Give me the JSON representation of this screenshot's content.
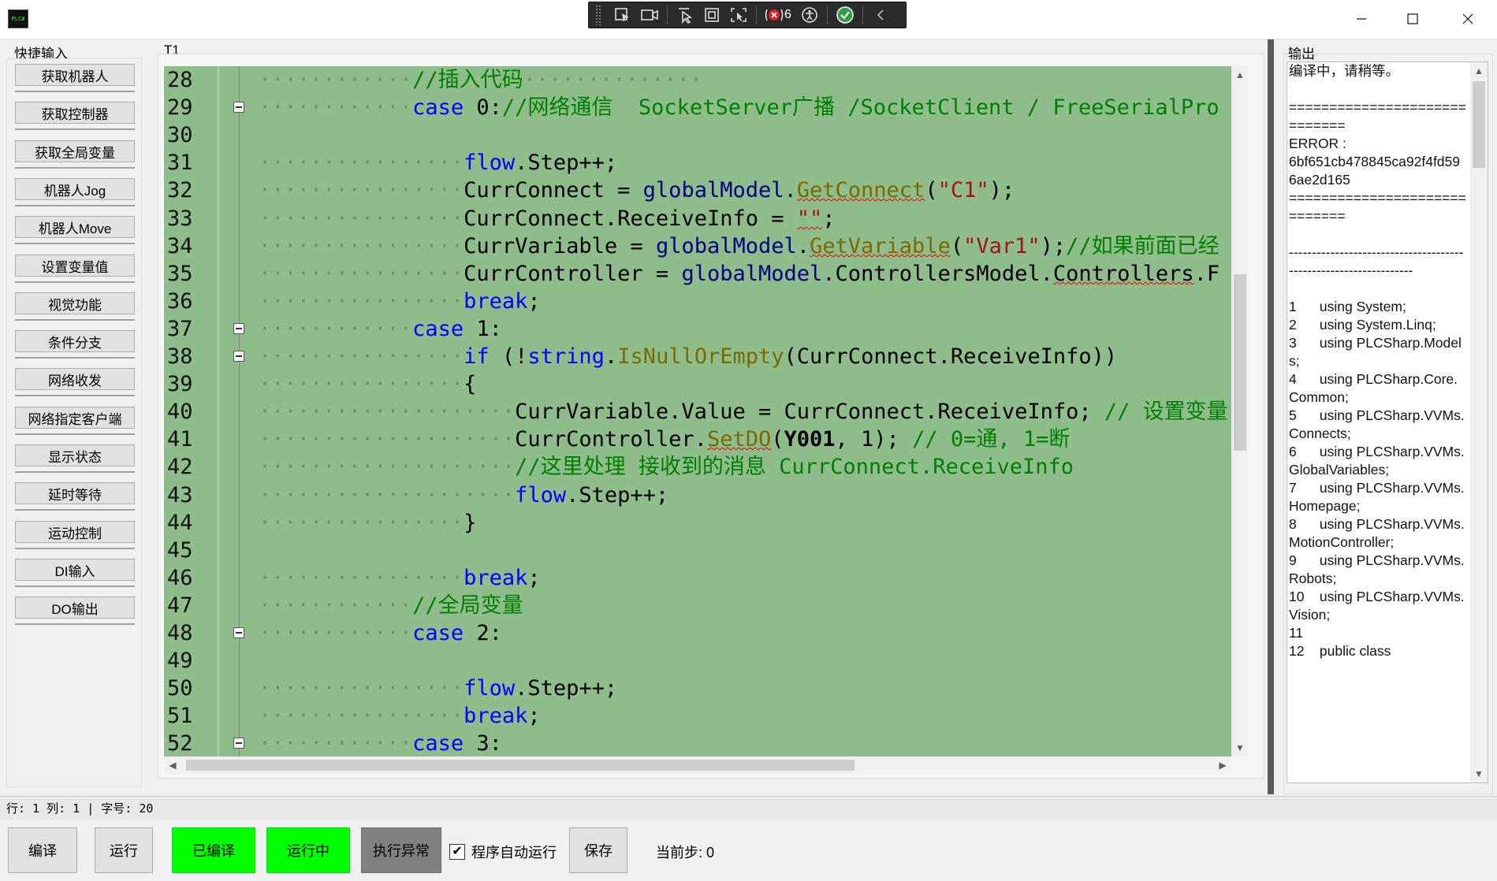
{
  "titlebar": {
    "app_icon_label": "PLC#",
    "window_controls": [
      "minimize",
      "maximize",
      "close"
    ],
    "debug_toolbar": {
      "icons": [
        "select-element-icon",
        "live-camera-icon",
        "pointer-icon",
        "frame-icon",
        "track-focus-icon",
        "binding-errors-icon",
        "accessibility-icon",
        "check-icon",
        "collapse-icon"
      ],
      "binding_error_count": "6"
    }
  },
  "quick_panel": {
    "title": "快捷输入",
    "buttons": [
      "获取机器人",
      "获取控制器",
      "获取全局变量",
      "机器人Jog",
      "机器人Move",
      "设置变量值",
      "视觉功能",
      "条件分支",
      "网络收发",
      "网络指定客户端",
      "显示状态",
      "延时等待",
      "运动控制",
      "DI输入",
      "DO输出"
    ]
  },
  "editor": {
    "tab": "T1",
    "background": "#8fbc8b",
    "lines": [
      {
        "n": "28",
        "dots": 12,
        "segs": [
          [
            "cm",
            "//插入代码"
          ],
          [
            "dots",
            "··············"
          ]
        ]
      },
      {
        "n": "29",
        "fold": true,
        "dots": 12,
        "segs": [
          [
            "kw",
            "case"
          ],
          [
            "",
            " 0:"
          ],
          [
            "cm",
            "//网络通信  SocketServer广播 /SocketClient / FreeSerialPro"
          ]
        ]
      },
      {
        "n": "30",
        "dots": 0,
        "segs": []
      },
      {
        "n": "31",
        "dots": 16,
        "segs": [
          [
            "kw",
            "flow"
          ],
          [
            "",
            ".Step++;"
          ]
        ]
      },
      {
        "n": "32",
        "dots": 16,
        "segs": [
          [
            "",
            "CurrConnect = "
          ],
          [
            "ty",
            "globalModel"
          ],
          [
            "",
            "."
          ],
          [
            "mt squig",
            "GetConnect"
          ],
          [
            "",
            "("
          ],
          [
            "st",
            "\"C1\""
          ],
          [
            "",
            ");"
          ]
        ]
      },
      {
        "n": "33",
        "dots": 16,
        "segs": [
          [
            "",
            "CurrConnect.ReceiveInfo = "
          ],
          [
            "st squig",
            "\"\""
          ],
          [
            "",
            ";"
          ]
        ]
      },
      {
        "n": "34",
        "dots": 16,
        "segs": [
          [
            "",
            "CurrVariable = "
          ],
          [
            "ty",
            "globalModel"
          ],
          [
            "",
            "."
          ],
          [
            "mt squig",
            "GetVariable"
          ],
          [
            "",
            "("
          ],
          [
            "st",
            "\"Var1\""
          ],
          [
            "",
            ");"
          ],
          [
            "cm",
            "//如果前面已经"
          ]
        ]
      },
      {
        "n": "35",
        "dots": 16,
        "segs": [
          [
            "",
            "CurrController = "
          ],
          [
            "ty",
            "globalModel"
          ],
          [
            "",
            ".ControllersModel."
          ],
          [
            "squig",
            "Controllers"
          ],
          [
            "",
            ".F"
          ]
        ]
      },
      {
        "n": "36",
        "dots": 16,
        "segs": [
          [
            "kw",
            "break"
          ],
          [
            "",
            ";"
          ]
        ]
      },
      {
        "n": "37",
        "fold": true,
        "dots": 12,
        "segs": [
          [
            "kw",
            "case"
          ],
          [
            "",
            " 1:"
          ]
        ]
      },
      {
        "n": "38",
        "fold": true,
        "dots": 16,
        "segs": [
          [
            "kw",
            "if"
          ],
          [
            "",
            " (!"
          ],
          [
            "kw",
            "string"
          ],
          [
            "",
            "."
          ],
          [
            "mt",
            "IsNullOrEmpty"
          ],
          [
            "",
            "(CurrConnect.ReceiveInfo))"
          ]
        ]
      },
      {
        "n": "39",
        "dots": 16,
        "segs": [
          [
            "",
            "{"
          ]
        ]
      },
      {
        "n": "40",
        "dots": 20,
        "segs": [
          [
            "",
            "CurrVariable.Value = CurrConnect.ReceiveInfo; "
          ],
          [
            "cm",
            "// 设置变量"
          ]
        ]
      },
      {
        "n": "41",
        "dots": 20,
        "segs": [
          [
            "",
            "CurrController."
          ],
          [
            "mt squig",
            "SetDO"
          ],
          [
            "",
            "("
          ],
          [
            "bd",
            "Y001"
          ],
          [
            "",
            ", 1); "
          ],
          [
            "cm",
            "// 0=通, 1=断"
          ]
        ]
      },
      {
        "n": "42",
        "dots": 20,
        "segs": [
          [
            "cm",
            "//这里处理 接收到的消息 CurrConnect.ReceiveInfo"
          ]
        ]
      },
      {
        "n": "43",
        "dots": 20,
        "segs": [
          [
            "kw",
            "flow"
          ],
          [
            "",
            ".Step++;"
          ]
        ]
      },
      {
        "n": "44",
        "dots": 16,
        "segs": [
          [
            "",
            "}"
          ]
        ]
      },
      {
        "n": "45",
        "dots": 0,
        "segs": []
      },
      {
        "n": "46",
        "dots": 16,
        "segs": [
          [
            "kw",
            "break"
          ],
          [
            "",
            ";"
          ]
        ]
      },
      {
        "n": "47",
        "dots": 12,
        "segs": [
          [
            "cm",
            "//全局变量"
          ]
        ]
      },
      {
        "n": "48",
        "fold": true,
        "dots": 12,
        "segs": [
          [
            "kw",
            "case"
          ],
          [
            "",
            " 2:"
          ]
        ]
      },
      {
        "n": "49",
        "dots": 0,
        "segs": []
      },
      {
        "n": "50",
        "dots": 16,
        "segs": [
          [
            "kw",
            "flow"
          ],
          [
            "",
            ".Step++;"
          ]
        ]
      },
      {
        "n": "51",
        "dots": 16,
        "segs": [
          [
            "kw",
            "break"
          ],
          [
            "",
            ";"
          ]
        ]
      },
      {
        "n": "52",
        "fold": true,
        "dots": 12,
        "segs": [
          [
            "kw",
            "case"
          ],
          [
            "",
            " 3:"
          ]
        ]
      }
    ]
  },
  "output_panel": {
    "title": "输出",
    "text": "编译中，请稍等。\n\n=============================\nERROR :\n6bf651cb478845ca92f4fd596ae2d165\n=============================\n\n-----------------------------------------------------------------\n\n1\tusing System;\n2\tusing System.Linq;\n3\tusing PLCSharp.Models;\n4\tusing PLCSharp.Core.Common;\n5\tusing PLCSharp.VVMs.Connects;\n6\tusing PLCSharp.VVMs.GlobalVariables;\n7\tusing PLCSharp.VVMs.Homepage;\n8\tusing PLCSharp.VVMs.MotionController;\n9\tusing PLCSharp.VVMs.Robots;\n10\tusing PLCSharp.VVMs.Vision;\n11\n12\tpublic class"
  },
  "statusbar": {
    "text": "行: 1  列: 1 | 字号: 20"
  },
  "bottombar": {
    "compile_label": "编译",
    "run_label": "运行",
    "compiled_label": "已编译",
    "running_label": "运行中",
    "exception_label": "执行异常",
    "autorun_label": "程序自动运行",
    "autorun_checked": true,
    "save_label": "保存",
    "current_step_label": "当前步: 0"
  },
  "colors": {
    "code_bg": "#8fbc8b",
    "status_green": "#00ff00",
    "exception_gray": "#808080",
    "keyword": "#0000ff",
    "comment": "#008000",
    "string": "#a31515"
  }
}
